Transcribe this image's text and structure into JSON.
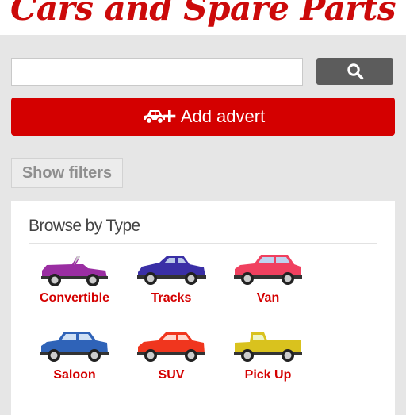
{
  "header": {
    "logo_text": "Cars and Spare Parts"
  },
  "search": {
    "value": "",
    "placeholder": "",
    "button_icon": "search-icon"
  },
  "actions": {
    "add_advert_label": "Add advert",
    "add_advert_icon": "car-plus-icon",
    "show_filters_label": "Show filters"
  },
  "browse": {
    "title": "Browse by Type",
    "types": [
      {
        "label": "Convertible",
        "color": "#9a2ea2",
        "icon": "convertible-car-icon"
      },
      {
        "label": "Tracks",
        "color": "#3a2fa6",
        "icon": "sports-car-icon"
      },
      {
        "label": "Van",
        "color": "#f0405f",
        "icon": "hatchback-car-icon"
      },
      {
        "label": "Saloon",
        "color": "#2f63b8",
        "icon": "saloon-car-icon"
      },
      {
        "label": "SUV",
        "color": "#f0361e",
        "icon": "suv-car-icon"
      },
      {
        "label": "Pick Up",
        "color": "#d9c21e",
        "icon": "pickup-truck-icon"
      }
    ]
  },
  "colors": {
    "brand_red": "#d40000",
    "search_button": "#5c5c5c"
  }
}
